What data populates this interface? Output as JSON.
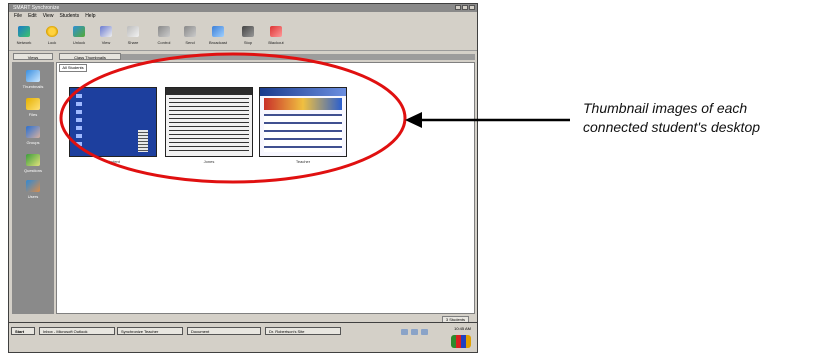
{
  "window": {
    "title": "SMART Synchronize",
    "menu": [
      "File",
      "Edit",
      "View",
      "Students",
      "Help"
    ]
  },
  "toolbar": {
    "buttons": [
      {
        "label": "Network",
        "icon": "network-icon"
      },
      {
        "label": "Lock",
        "icon": "lock-icon"
      },
      {
        "label": "Unlock",
        "icon": "unlock-icon"
      },
      {
        "label": "View",
        "icon": "view-icon"
      },
      {
        "label": "Share",
        "icon": "share-icon"
      },
      {
        "label": "Control",
        "icon": "control-icon"
      },
      {
        "label": "Send",
        "icon": "send-icon"
      },
      {
        "label": "Broadcast",
        "icon": "broadcast-icon"
      },
      {
        "label": "Stop",
        "icon": "stop-icon"
      },
      {
        "label": "Blackout",
        "icon": "blackout-icon"
      }
    ]
  },
  "tabs": {
    "views": "Views",
    "class": "Class Thumbnails"
  },
  "sidebar": {
    "items": [
      {
        "label": "Thumbnails",
        "icon": "monitor-icon"
      },
      {
        "label": "Files",
        "icon": "folder-icon"
      },
      {
        "label": "Groups",
        "icon": "users-icon"
      },
      {
        "label": "Questions",
        "icon": "clipboard-icon"
      },
      {
        "label": "Users",
        "icon": "person-icon"
      }
    ]
  },
  "content": {
    "subtab": "All Students",
    "thumbnails": [
      {
        "caption": "Student"
      },
      {
        "caption": "Jones"
      },
      {
        "caption": "Teacher"
      }
    ]
  },
  "status": {
    "count": "3 Students"
  },
  "taskbar": {
    "start": "Start",
    "tasks": [
      "Inbox - Microsoft Outlook",
      "Synchronize Teacher",
      "Document",
      "Dr. Robertson's Site"
    ],
    "clock": "10:45 AM"
  },
  "annotation": {
    "line1": "Thumbnail images of each",
    "line2": "connected student's desktop"
  },
  "colors": {
    "highlight_ellipse": "#e01010",
    "arrow": "#000000"
  }
}
